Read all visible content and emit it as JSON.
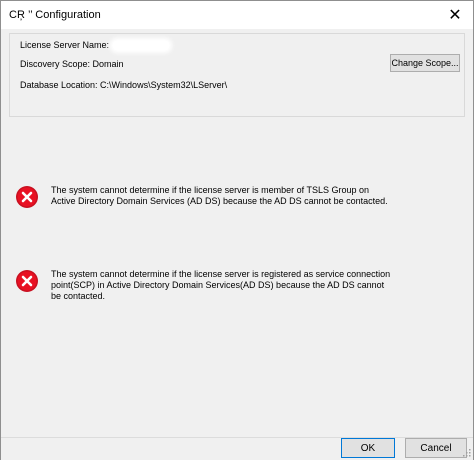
{
  "window": {
    "title": "CŖ ’’ Configuration",
    "close_glyph": "✕"
  },
  "info": {
    "license_server_label": "License Server Name:",
    "discovery_scope": "Discovery Scope: Domain",
    "database_location": "Database Location: C:\\Windows\\System32\\LServer\\",
    "change_scope_label": "Change Scope..."
  },
  "errors": [
    {
      "icon": "error-icon",
      "text": "The system cannot determine if the license server is member of TSLS Group on Active Directory Domain Services (AD DS) because the AD DS cannot be contacted."
    },
    {
      "icon": "error-icon",
      "text": "The system cannot determine if the license server is registered as service connection point(SCP) in Active Directory Domain Services(AD DS) because the AD DS cannot be contacted."
    }
  ],
  "footer": {
    "ok_label": "OK",
    "cancel_label": "Cancel"
  },
  "colors": {
    "error_red": "#e81123",
    "dialog_bg": "#f0f0f0",
    "focus_blue": "#0078d7"
  }
}
